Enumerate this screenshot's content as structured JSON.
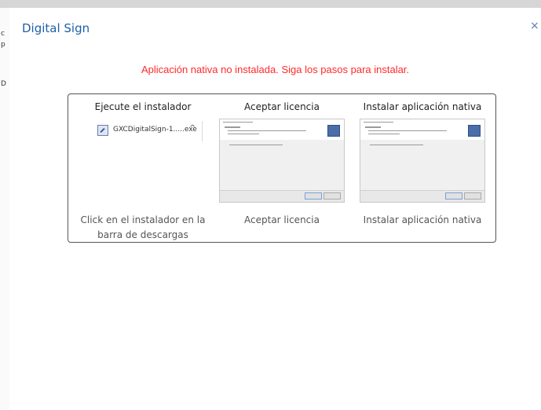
{
  "dialog": {
    "title": "Digital Sign",
    "close_glyph": "×"
  },
  "warning": "Aplicación nativa no instalada. Siga los pasos para instalar.",
  "steps": [
    {
      "heading": "Ejecute el instalador",
      "caption": "Click en el instalador en la barra de descargas"
    },
    {
      "heading": "Aceptar licencia",
      "caption": "Aceptar licencia"
    },
    {
      "heading": "Instalar aplicación nativa",
      "caption": "Instalar aplicación nativa"
    }
  ],
  "download_bar": {
    "file_name": "GXCDigitalSign-1.....exe",
    "caret_glyph": "^",
    "icon": "installer-file-icon"
  },
  "colors": {
    "title": "#1f5fa8",
    "warning": "#ff2a2a",
    "panel_border": "#555555"
  }
}
